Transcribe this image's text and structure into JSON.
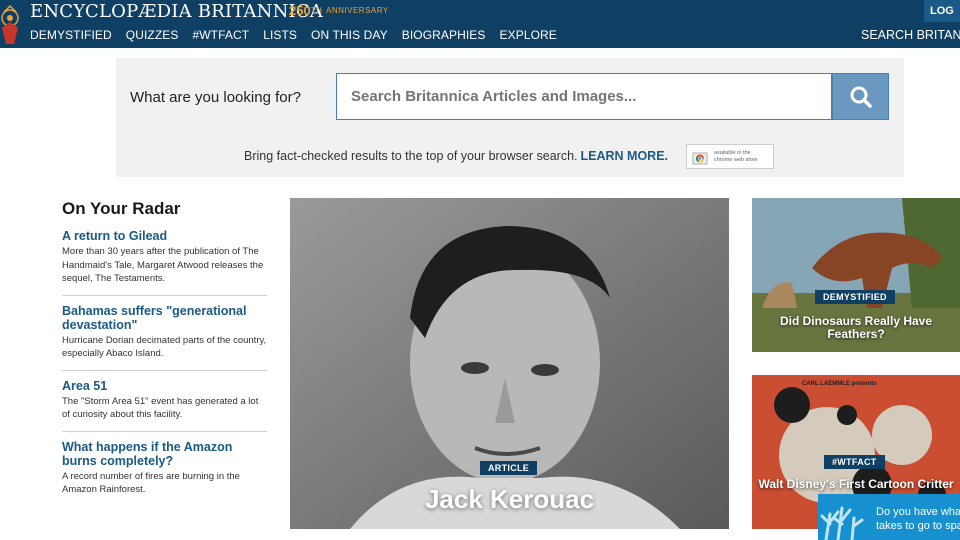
{
  "header": {
    "brand": "ENCYCLOPÆDIA BRITANNICA",
    "anniversary_number": "250",
    "anniversary_suffix": "TH",
    "anniversary_text": "ANNIVERSARY",
    "login_label": "LOG",
    "nav": [
      "DEMYSTIFIED",
      "QUIZZES",
      "#WTFACT",
      "LISTS",
      "ON THIS DAY",
      "BIOGRAPHIES",
      "EXPLORE"
    ],
    "search_label": "SEARCH BRITANNICA"
  },
  "search": {
    "prompt": "What are you looking for?",
    "placeholder": "Search Britannica Articles and Images...",
    "promo_text": "Bring fact-checked results to the top of your browser search.",
    "learn_more": "LEARN MORE.",
    "chrome_badge_line1": "available in the",
    "chrome_badge_line2": "chrome web store"
  },
  "radar": {
    "title": "On Your Radar",
    "items": [
      {
        "headline": "A return to Gilead",
        "description": "More than 30 years after the publication of The Handmaid's Tale, Margaret Atwood releases the sequel, The Testaments."
      },
      {
        "headline": "Bahamas suffers \"generational devastation\"",
        "description": "Hurricane Dorian decimated parts of the country, especially Abaco Island."
      },
      {
        "headline": "Area 51",
        "description": "The \"Storm Area 51\" event has generated a lot of curiosity about this facility."
      },
      {
        "headline": "What happens if the Amazon burns completely?",
        "description": "A record number of fires are burning in the Amazon Rainforest."
      }
    ]
  },
  "feature": {
    "badge": "ARTICLE",
    "title": "Jack Kerouac"
  },
  "cards": [
    {
      "badge": "DEMYSTIFIED",
      "title": "Did Dinosaurs Really Have Feathers?"
    },
    {
      "badge": "#WTFACT",
      "title": "Walt Disney's First Cartoon Critter",
      "image_caption": "CARL LAEMMLE presents"
    }
  ],
  "popup": {
    "line1": "Do you have wha",
    "line2": "takes to go to spa"
  },
  "colors": {
    "header_bg": "#0f3f63",
    "link_blue": "#1a5a86",
    "search_button": "#6b98c0",
    "anniversary_gold": "#e8a33a",
    "popup_blue": "#1790d0"
  }
}
